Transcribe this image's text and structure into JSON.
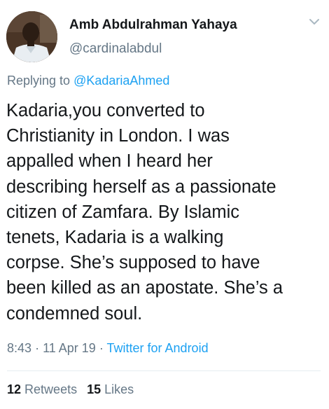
{
  "tweet": {
    "author": {
      "display_name": "Amb Abdulrahman Yahaya",
      "handle": "@cardinalabdul",
      "avatar_icon": "user-avatar"
    },
    "menu_icon": "chevron-down-icon",
    "replying_prefix": "Replying to",
    "replying_to": "@KadariaAhmed",
    "text": "Kadaria,you  converted to\nChristianity in London. I was\nappalled when I heard her\ndescribing herself as a passionate\ncitizen of Zamfara. By Islamic\ntenets, Kadaria is a walking\ncorpse. She’s supposed to have\nbeen killed as an apostate. She’s a\ncondemned soul.",
    "time": "8:43",
    "separator": "·",
    "date": "11 Apr 19",
    "source": "Twitter for Android",
    "retweets_count": "12",
    "retweets_label": "Retweets",
    "likes_count": "15",
    "likes_label": "Likes"
  },
  "colors": {
    "text": "#14171a",
    "secondary": "#657786",
    "link": "#1da1f2",
    "divider": "#e6ecf0"
  }
}
